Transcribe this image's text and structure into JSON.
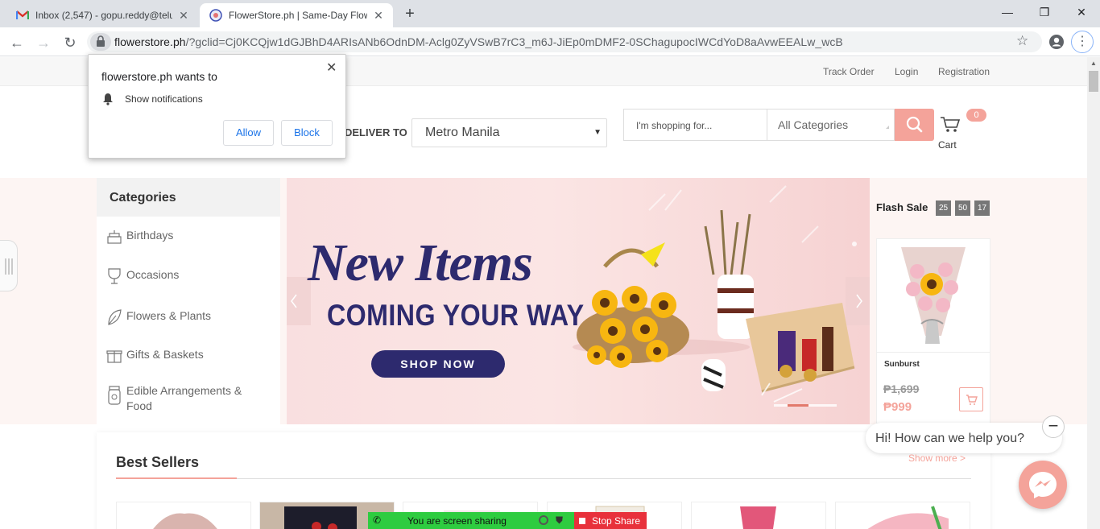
{
  "browser": {
    "tabs": [
      {
        "title": "Inbox (2,547) - gopu.reddy@telu",
        "icon": "gmail-icon"
      },
      {
        "title": "FlowerStore.ph | Same-Day Flowe",
        "icon": "flowerstore-icon"
      }
    ],
    "url_host": "flowerstore.ph",
    "url_rest": "/?gclid=Cj0KCQjw1dGJBhD4ARIsANb6OdnDM-Aclg0ZyVSwB7rC3_m6J-JiEp0mDMF2-0SChagupocIWCdYoD8aAvwEEALw_wcB"
  },
  "notification_popup": {
    "title": "flowerstore.ph wants to",
    "text": "Show notifications",
    "allow": "Allow",
    "block": "Block"
  },
  "top_links": [
    "Track Order",
    "Login",
    "Registration"
  ],
  "deliver": {
    "label": "DELIVER TO",
    "city": "Metro Manila"
  },
  "search": {
    "placeholder": "I'm shopping for...",
    "category": "All Categories"
  },
  "cart": {
    "label": "Cart",
    "count": "0"
  },
  "categories": {
    "title": "Categories",
    "items": [
      {
        "label": "Birthdays",
        "icon": "cake-icon"
      },
      {
        "label": "Occasions",
        "icon": "glass-icon"
      },
      {
        "label": "Flowers & Plants",
        "icon": "leaf-icon"
      },
      {
        "label": "Gifts & Baskets",
        "icon": "gift-icon"
      },
      {
        "label": "Edible Arrangements & Food",
        "icon": "jar-icon"
      }
    ]
  },
  "banner": {
    "line1": "New Items",
    "line2": "COMING YOUR WAY",
    "cta": "SHOP NOW"
  },
  "flash_sale": {
    "title": "Flash Sale",
    "timer": [
      "25",
      "50",
      "17"
    ],
    "product": {
      "name": "Sunburst",
      "old_price": "₱1,699",
      "price": "₱999"
    }
  },
  "best_sellers": {
    "title": "Best Sellers"
  },
  "chat": {
    "greeting": "Hi! How can we help you?",
    "more": "Show more >"
  },
  "screenshare": {
    "text": "You are screen sharing",
    "stop": "Stop Share"
  },
  "colors": {
    "accent": "#f4a39a",
    "banner_navy": "#2d2a6e",
    "share_green": "#2ecc40",
    "share_red": "#e8313b"
  }
}
